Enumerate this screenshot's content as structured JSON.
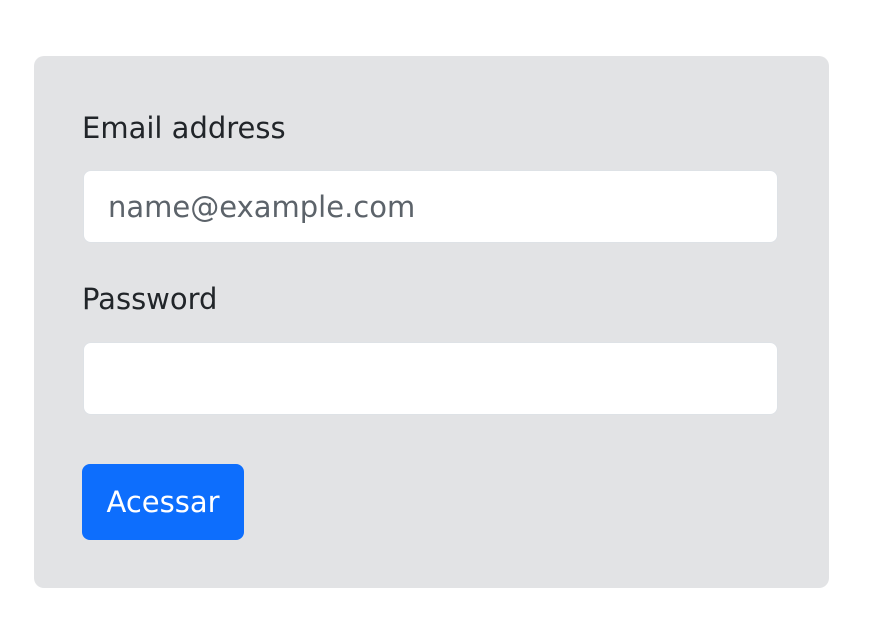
{
  "form": {
    "email_label": "Email address",
    "email_placeholder": "name@example.com",
    "email_value": "",
    "password_label": "Password",
    "password_placeholder": "",
    "password_value": "",
    "submit_label": "Acessar"
  },
  "colors": {
    "page_background": "#ffffff",
    "card_background": "#e2e3e5",
    "input_background": "#ffffff",
    "primary_button": "#0d6efd",
    "primary_button_text": "#ffffff",
    "label_text": "#212529",
    "placeholder_text": "#5c636a"
  }
}
